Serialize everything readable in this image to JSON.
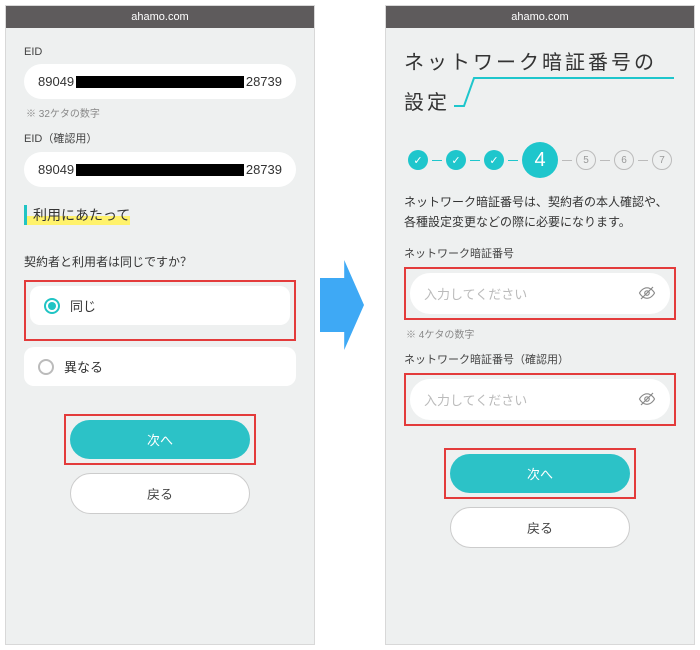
{
  "url": "ahamo.com",
  "left": {
    "eid_label": "EID",
    "eid_value_prefix": "89049",
    "eid_value_suffix": "28739",
    "eid_note": "※ 32ケタの数字",
    "eid_confirm_label": "EID（確認用）",
    "section_title": "利用にあたって",
    "question": "契約者と利用者は同じですか？",
    "option_same": "同じ",
    "option_diff": "異なる",
    "next": "次へ",
    "back": "戻る"
  },
  "right": {
    "title_line1": "ネットワーク暗証番号の",
    "title_line2": "設定",
    "steps": {
      "current": "4",
      "todo": [
        "5",
        "6",
        "7"
      ]
    },
    "description": "ネットワーク暗証番号は、契約者の本人確認や、各種設定変更などの際に必要になります。",
    "pin_label": "ネットワーク暗証番号",
    "pin_placeholder": "入力してください",
    "pin_note": "※ 4ケタの数字",
    "pin_confirm_label": "ネットワーク暗証番号（確認用）",
    "pin_confirm_placeholder": "入力してください",
    "next": "次へ",
    "back": "戻る"
  }
}
